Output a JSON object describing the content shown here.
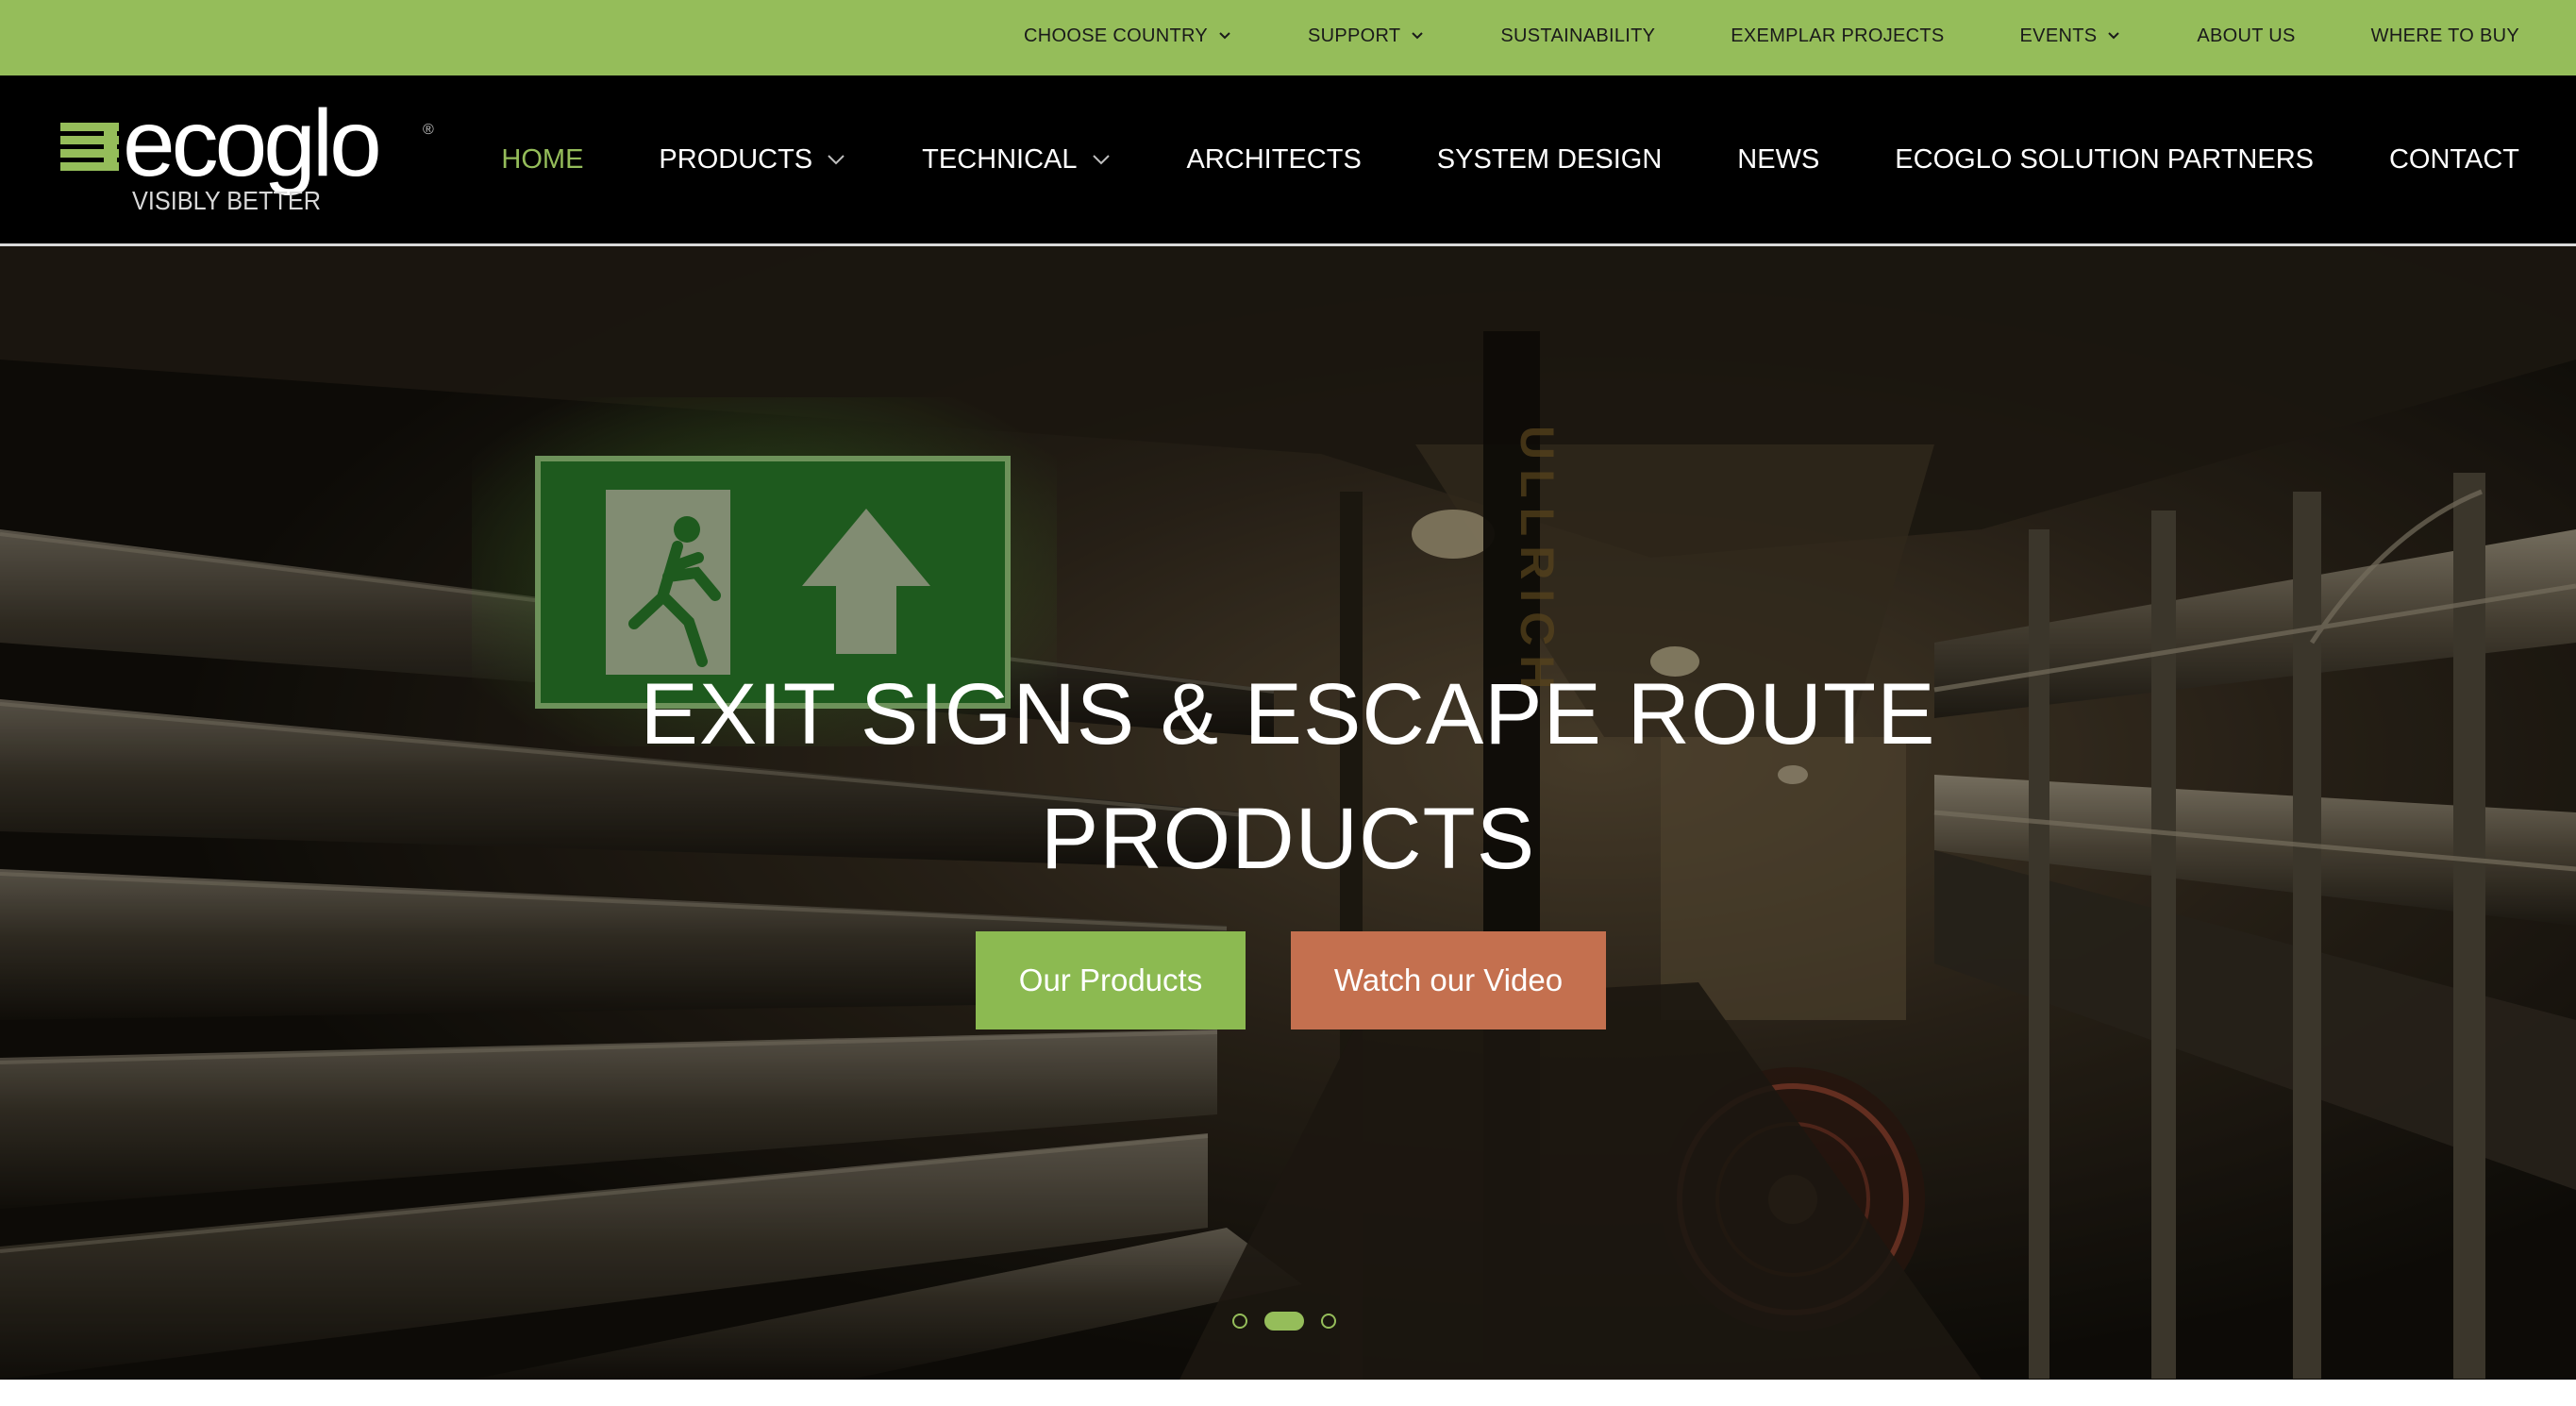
{
  "topbar": {
    "bg_color": "#95bd5a",
    "items": [
      {
        "label": "CHOOSE COUNTRY",
        "has_dropdown": true
      },
      {
        "label": "SUPPORT",
        "has_dropdown": true
      },
      {
        "label": "SUSTAINABILITY",
        "has_dropdown": false
      },
      {
        "label": "EXEMPLAR PROJECTS",
        "has_dropdown": false
      },
      {
        "label": "EVENTS",
        "has_dropdown": true
      },
      {
        "label": "ABOUT US",
        "has_dropdown": false
      },
      {
        "label": "WHERE TO BUY",
        "has_dropdown": false
      }
    ]
  },
  "header": {
    "logo": {
      "brand": "ecoglo",
      "tagline": "VISIBLY BETTER",
      "mark": "®"
    },
    "nav": [
      {
        "label": "HOME",
        "active": true,
        "has_dropdown": false
      },
      {
        "label": "PRODUCTS",
        "active": false,
        "has_dropdown": true
      },
      {
        "label": "TECHNICAL",
        "active": false,
        "has_dropdown": true
      },
      {
        "label": "ARCHITECTS",
        "active": false,
        "has_dropdown": false
      },
      {
        "label": "SYSTEM DESIGN",
        "active": false,
        "has_dropdown": false
      },
      {
        "label": "NEWS",
        "active": false,
        "has_dropdown": false
      },
      {
        "label": "ECOGLO SOLUTION PARTNERS",
        "active": false,
        "has_dropdown": false
      },
      {
        "label": "CONTACT",
        "active": false,
        "has_dropdown": false
      }
    ]
  },
  "hero": {
    "title_line1": "EXIT SIGNS & ESCAPE ROUTE",
    "title_line2": "PRODUCTS",
    "primary_button": "Our Products",
    "secondary_button": "Watch our Video",
    "pipe_text": "ULLRICH",
    "slider": {
      "count": 3,
      "active_index": 1
    },
    "colors": {
      "accent_green": "#8cba51",
      "accent_terracotta": "#c4704f",
      "exit_sign_green": "#2e8b2e"
    }
  }
}
